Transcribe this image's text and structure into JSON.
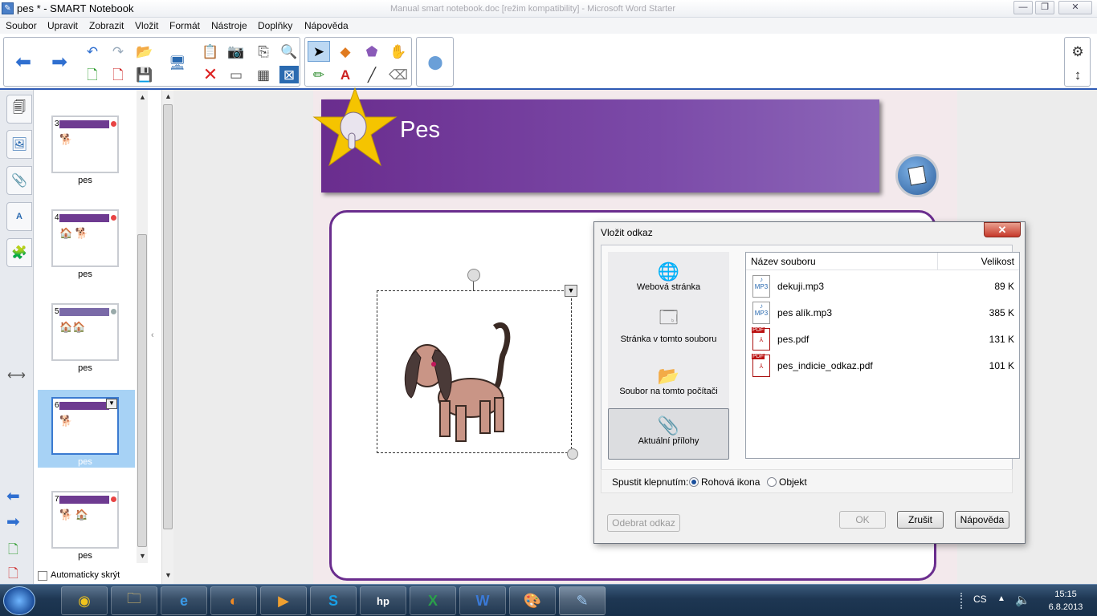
{
  "window": {
    "title": "pes * - SMART Notebook",
    "background_title": "Manual smart notebook.doc [režim kompatibility] - Microsoft Word Starter",
    "controls": {
      "minimize": "—",
      "maximize": "❐",
      "close": "✕"
    }
  },
  "menu": [
    "Soubor",
    "Upravit",
    "Zobrazit",
    "Vložit",
    "Formát",
    "Nástroje",
    "Doplňky",
    "Nápověda"
  ],
  "sorter": {
    "pages": [
      {
        "num": "3",
        "label": "pes"
      },
      {
        "num": "4",
        "label": "pes"
      },
      {
        "num": "5",
        "label": "pes"
      },
      {
        "num": "6",
        "label": "pes",
        "selected": true
      },
      {
        "num": "7",
        "label": "pes"
      }
    ],
    "auto_hide_label": "Automaticky skrýt"
  },
  "page": {
    "heading": "Pes"
  },
  "dialog": {
    "title": "Vložit odkaz",
    "close_label": "✕",
    "link_options": [
      {
        "label": "Webová stránka",
        "icon": "globe-icon"
      },
      {
        "label": "Stránka v tomto souboru",
        "icon": "page-icon"
      },
      {
        "label": "Soubor na tomto počítači",
        "icon": "folder-icon"
      },
      {
        "label": "Aktuální přílohy",
        "icon": "paperclip-icon",
        "selected": true
      }
    ],
    "file_list": {
      "col_name": "Název souboru",
      "col_size": "Velikost",
      "files": [
        {
          "name": "dekuji.mp3",
          "size": "89 K",
          "type": "MP3"
        },
        {
          "name": "pes alík.mp3",
          "size": "385 K",
          "type": "MP3"
        },
        {
          "name": "pes.pdf",
          "size": "131 K",
          "type": "PDF"
        },
        {
          "name": "pes_indicie_odkaz.pdf",
          "size": "101 K",
          "type": "PDF"
        }
      ]
    },
    "run_label": "Spustit klepnutím:",
    "radio_corner": "Rohová ikona",
    "radio_object": "Objekt",
    "remove_link": "Odebrat odkaz",
    "ok": "OK",
    "cancel": "Zrušit",
    "help": "Nápověda"
  },
  "taskbar": {
    "lang": "CS",
    "time": "15:15",
    "date": "6.8.2013"
  }
}
